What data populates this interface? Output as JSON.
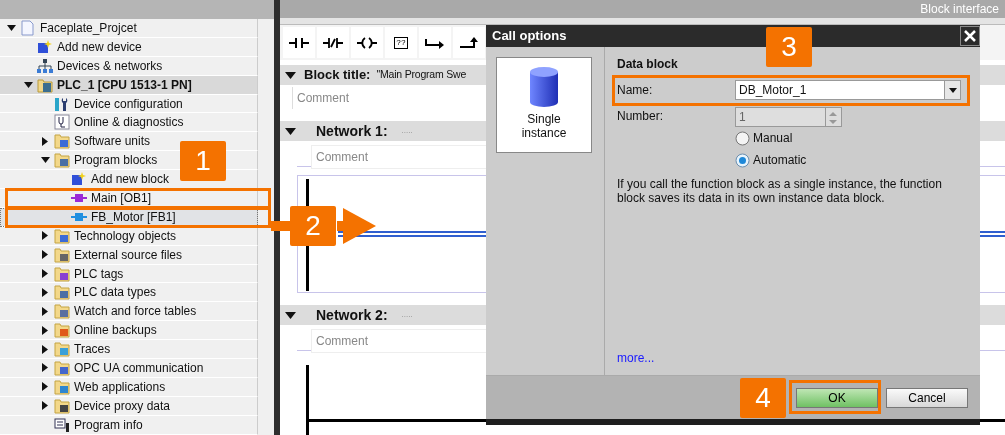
{
  "tree": [
    {
      "label": "Faceplate_Projcet",
      "kind": "group",
      "expanded": true,
      "selected": false,
      "children": [
        {
          "label": "Add new device",
          "kind": "item",
          "selected": false
        },
        {
          "label": "Devices & networks",
          "kind": "item",
          "selected": false
        },
        {
          "label": "PLC_1 [CPU 1513-1 PN]",
          "kind": "device",
          "expanded": true,
          "selected": false,
          "children": [
            {
              "label": "Device configuration",
              "kind": "item",
              "selected": false
            },
            {
              "label": "Online & diagnostics",
              "kind": "item",
              "selected": false
            },
            {
              "label": "Software units",
              "kind": "group",
              "expanded": false,
              "selected": false
            },
            {
              "label": "Program blocks",
              "kind": "group",
              "expanded": true,
              "selected": false,
              "children": [
                {
                  "label": "Add new block",
                  "kind": "item",
                  "selected": false
                },
                {
                  "label": "Main [OB1]",
                  "kind": "item",
                  "selected": false
                },
                {
                  "label": "FB_Motor [FB1]",
                  "kind": "item",
                  "selected": true
                }
              ]
            },
            {
              "label": "Technology objects",
              "kind": "group",
              "expanded": false,
              "selected": false
            },
            {
              "label": "External source files",
              "kind": "group",
              "expanded": false,
              "selected": false
            },
            {
              "label": "PLC tags",
              "kind": "group",
              "expanded": false,
              "selected": false
            },
            {
              "label": "PLC data types",
              "kind": "group",
              "expanded": false,
              "selected": false
            },
            {
              "label": "Watch and force tables",
              "kind": "group",
              "expanded": false,
              "selected": false
            },
            {
              "label": "Online backups",
              "kind": "group",
              "expanded": false,
              "selected": false
            },
            {
              "label": "Traces",
              "kind": "group",
              "expanded": false,
              "selected": false
            },
            {
              "label": "OPC UA communication",
              "kind": "group",
              "expanded": false,
              "selected": false
            },
            {
              "label": "Web applications",
              "kind": "group",
              "expanded": false,
              "selected": false
            },
            {
              "label": "Device proxy data",
              "kind": "group",
              "expanded": false,
              "selected": false
            },
            {
              "label": "Program info",
              "kind": "item",
              "selected": false
            }
          ]
        }
      ]
    }
  ],
  "editor": {
    "header_title": "Block interface",
    "toolbar": [
      {
        "kind": "no-contact"
      },
      {
        "kind": "nc-contact"
      },
      {
        "kind": "coil"
      },
      {
        "kind": "empty-box",
        "label": "??"
      },
      {
        "kind": "open-branch"
      },
      {
        "kind": "close-branch"
      }
    ],
    "block_title": {
      "label": "Block title:",
      "value": "\"Main Program Swe",
      "expanded": true,
      "comment_placeholder": "Comment"
    },
    "networks": [
      {
        "title": "Network 1:",
        "subtitle": ".....",
        "expanded": true,
        "comment_placeholder": "Comment"
      },
      {
        "title": "Network 2:",
        "subtitle": ".....",
        "expanded": true,
        "comment_placeholder": "Comment"
      }
    ]
  },
  "dialog": {
    "title": "Call options",
    "instance_option": "Single instance",
    "section_title": "Data block",
    "name": {
      "label": "Name:",
      "value": "DB_Motor_1"
    },
    "number": {
      "label": "Number:",
      "value": "1",
      "disabled": true
    },
    "options": [
      {
        "label": "Manual",
        "selected": false
      },
      {
        "label": "Automatic",
        "selected": true
      }
    ],
    "description": "If you call the function block as a single instance, the function block saves its data in its own instance data block.",
    "more_link": "more...",
    "buttons": [
      {
        "label": "OK",
        "kind": "primary"
      },
      {
        "label": "Cancel",
        "kind": "secondary"
      }
    ]
  },
  "callouts": [
    {
      "number": "1"
    },
    {
      "number": "2"
    },
    {
      "number": "3"
    },
    {
      "number": "4"
    }
  ]
}
